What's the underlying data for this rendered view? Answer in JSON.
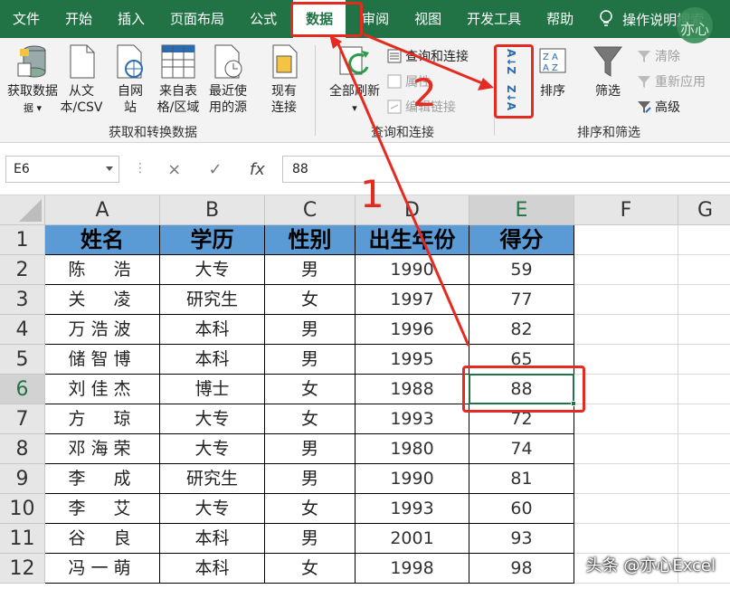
{
  "menu": {
    "tabs": [
      "文件",
      "开始",
      "插入",
      "页面布局",
      "公式",
      "数据",
      "审阅",
      "视图",
      "开发工具",
      "帮助"
    ],
    "active_index": 5,
    "tell_me": "操作说明搜索"
  },
  "ribbon": {
    "get_data": "获取数据",
    "from_text": "从文本/CSV",
    "from_web": "自网站",
    "from_table": "来自表格/区域",
    "recent": "最近使用的源",
    "existing": "现有连接",
    "group1": "获取和转换数据",
    "refresh_all": "全部刷新",
    "queries": "查询和连接",
    "properties": "属性",
    "edit_links": "编辑链接",
    "group2": "查询和连接",
    "sort_az_glyph": "A↓Z",
    "sort_za_glyph": "Z↓A",
    "sort": "排序",
    "filter": "筛选",
    "clear": "清除",
    "reapply": "重新应用",
    "advanced": "高级",
    "group3": "排序和筛选"
  },
  "formula_bar": {
    "name_box": "E6",
    "cancel": "×",
    "enter": "✓",
    "fx": "fx",
    "value": "88"
  },
  "sheet": {
    "columns": [
      "A",
      "B",
      "C",
      "D",
      "E",
      "F",
      "G"
    ],
    "rows": [
      "1",
      "2",
      "3",
      "4",
      "5",
      "6",
      "7",
      "8",
      "9",
      "10",
      "11",
      "12"
    ],
    "selected_row": 6,
    "selected_col": "E",
    "headers": [
      "姓名",
      "学历",
      "性别",
      "出生年份",
      "得分"
    ],
    "data": [
      [
        "陈　浩",
        "大专",
        "男",
        "1990",
        "59"
      ],
      [
        "关　凌",
        "研究生",
        "女",
        "1997",
        "77"
      ],
      [
        "万浩波",
        "本科",
        "男",
        "1996",
        "82"
      ],
      [
        "储智博",
        "本科",
        "男",
        "1995",
        "65"
      ],
      [
        "刘佳杰",
        "博士",
        "女",
        "1988",
        "88"
      ],
      [
        "方　琼",
        "大专",
        "女",
        "1993",
        "72"
      ],
      [
        "邓海荣",
        "大专",
        "男",
        "1980",
        "74"
      ],
      [
        "李　成",
        "研究生",
        "男",
        "1990",
        "81"
      ],
      [
        "李　艾",
        "大专",
        "女",
        "1993",
        "60"
      ],
      [
        "谷　良",
        "本科",
        "男",
        "2001",
        "93"
      ],
      [
        "冯一萌",
        "本科",
        "女",
        "1998",
        "98"
      ]
    ]
  },
  "annotations": {
    "step1": "1",
    "step2": "2"
  },
  "watermark": "头条 @亦心Excel",
  "logo_text": "亦心",
  "colors": {
    "excel_green": "#217346",
    "header_fill": "#5b9bd5",
    "annotation_red": "#e52a20"
  }
}
